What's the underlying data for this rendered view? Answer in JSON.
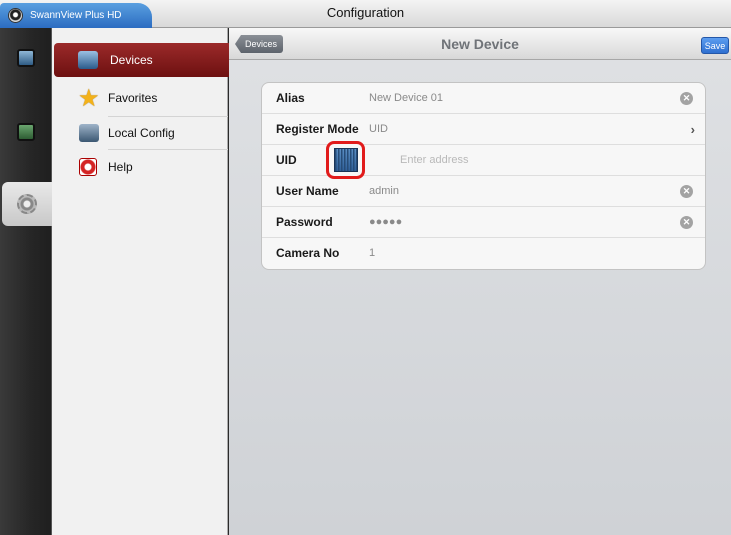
{
  "app": {
    "tab_label": "SwannView Plus HD",
    "window_title": "Configuration"
  },
  "rail": [
    {
      "name": "live-view",
      "icon": "monitor-icon"
    },
    {
      "name": "playback",
      "icon": "playback-icon"
    },
    {
      "name": "configuration",
      "icon": "gear-icon",
      "active": true
    }
  ],
  "menu": {
    "items": [
      {
        "label": "Devices",
        "icon": "devices-icon",
        "active": true
      },
      {
        "label": "Favorites",
        "icon": "star-icon"
      },
      {
        "label": "Local Config",
        "icon": "config-icon"
      },
      {
        "label": "Help",
        "icon": "lifebuoy-icon"
      }
    ]
  },
  "navbar": {
    "back_label": "Devices",
    "title": "New Device",
    "save_label": "Save"
  },
  "form": {
    "rows": [
      {
        "label": "Alias",
        "value": "New Device 01",
        "accessory": "clear-icon"
      },
      {
        "label": "Register Mode",
        "value": "UID",
        "accessory": "chevron-right-icon"
      },
      {
        "label": "UID",
        "placeholder": "Enter address",
        "accessory": "qr-code-icon"
      },
      {
        "label": "User Name",
        "value": "admin",
        "accessory": "clear-icon"
      },
      {
        "label": "Password",
        "value": "●●●●●",
        "accessory": "clear-icon"
      },
      {
        "label": "Camera No",
        "value": "1"
      }
    ]
  },
  "colors": {
    "accent_blue": "#2e6fd0",
    "menu_active": "#7d1616",
    "highlight_red": "#e11b1b"
  }
}
